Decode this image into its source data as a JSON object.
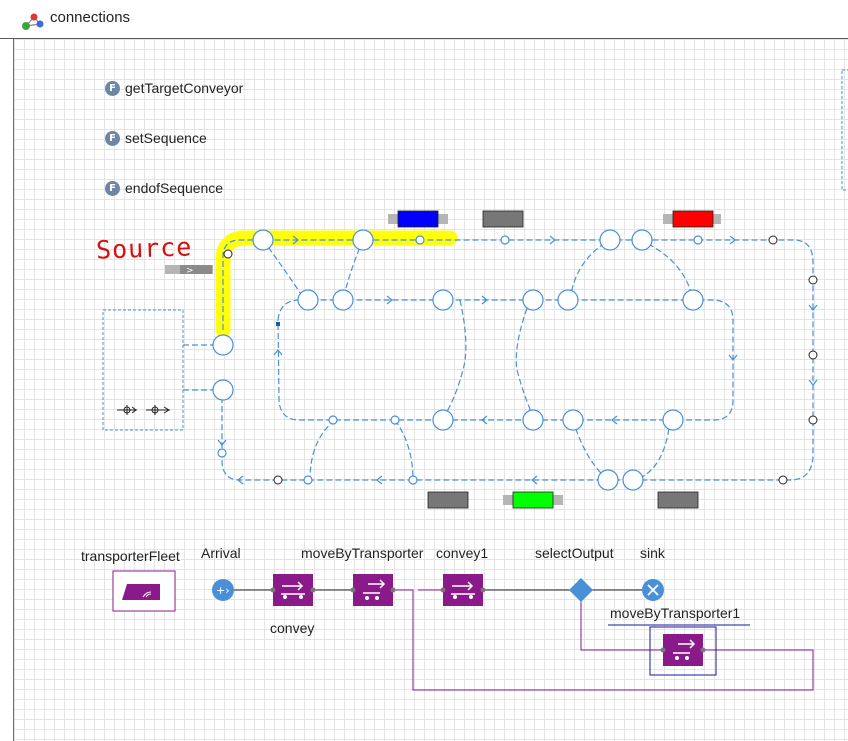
{
  "window": {
    "title": "connections"
  },
  "functions": [
    {
      "icon": "function-icon",
      "badge": "F",
      "label": "getTargetConveyor"
    },
    {
      "icon": "function-icon",
      "badge": "F",
      "label": "setSequence"
    },
    {
      "icon": "function-icon",
      "badge": "F",
      "label": "endofSequence"
    }
  ],
  "annotation": {
    "text": "Source",
    "color": "#d41010",
    "highlight_color": "#ffff00"
  },
  "blocks": {
    "transporterFleet": "transporterFleet",
    "arrival": "Arrival",
    "convey": "convey",
    "moveByTransporter": "moveByTransporter",
    "convey1": "convey1",
    "selectOutput": "selectOutput",
    "sink": "sink",
    "moveByTransporter1": "moveByTransporter1"
  },
  "stations": [
    {
      "color": "#0000ff",
      "label": "blue-station"
    },
    {
      "color": "#777777",
      "label": "gray-station"
    },
    {
      "color": "#ff0000",
      "label": "red-station"
    },
    {
      "color": "#777777",
      "label": "gray-station"
    },
    {
      "color": "#00ff00",
      "label": "green-station"
    },
    {
      "color": "#777777",
      "label": "gray-station"
    }
  ],
  "colors": {
    "path": "#4a90d9",
    "block": "#8a1a8a",
    "arrival_icon": "#4a90d9",
    "grid": "#e4e4e4"
  }
}
